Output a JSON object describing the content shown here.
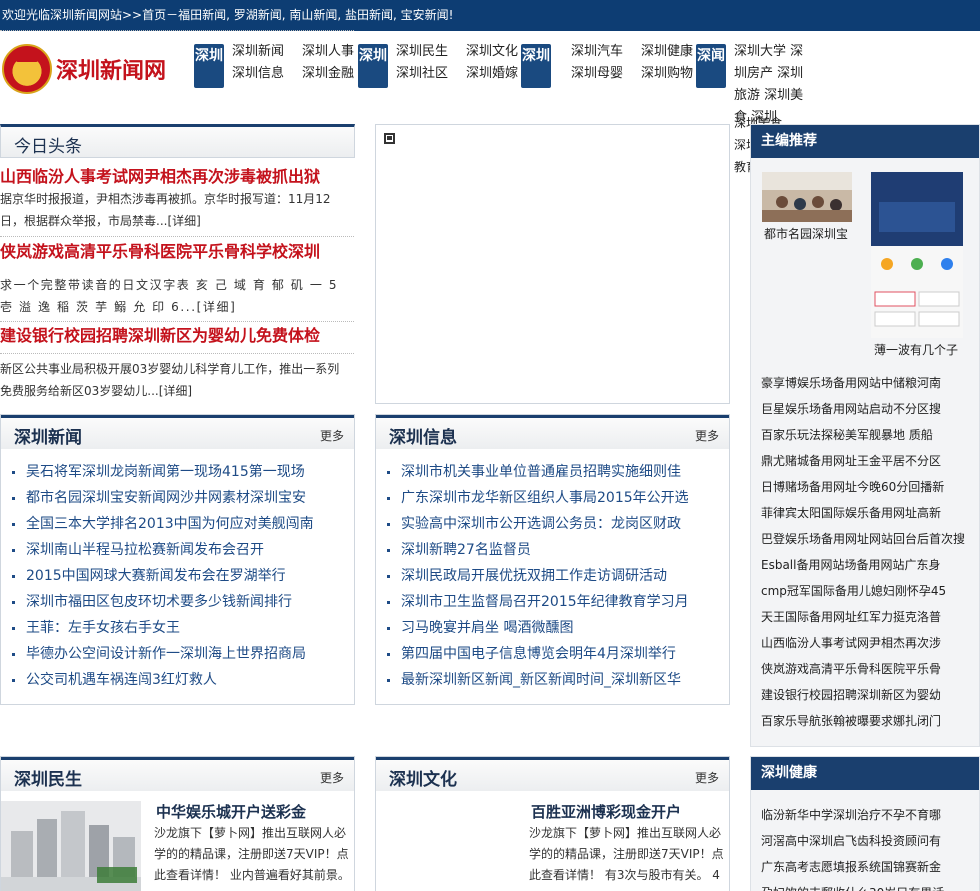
{
  "topbar": {
    "text": "欢迎光临深圳新闻网站>>首页－福田新闻, 罗湖新闻, 南山新闻, 盐田新闻, 宝安新闻!"
  },
  "logo": {
    "text": "深圳新闻网"
  },
  "nav": [
    {
      "badge": "深圳",
      "links": [
        "深圳新闻",
        "深圳人事",
        "深圳信息",
        "深圳金融"
      ]
    },
    {
      "badge": "深圳",
      "links": [
        "深圳民生",
        "深圳文化",
        "深圳社区",
        "深圳婚嫁"
      ]
    },
    {
      "badge": "深圳",
      "links": [
        "深圳汽车",
        "深圳健康",
        "深圳母婴",
        "深圳购物"
      ]
    },
    {
      "badge": "深闻",
      "links_text": "深圳大学 深圳房产 深圳旅游 深圳美食 深圳"
    }
  ],
  "header_leftover": [
    "深圳美食",
    "深圳",
    "教育"
  ],
  "headlines": {
    "title": "今日头条",
    "items": [
      {
        "title": "山西临汾人事考试网尹相杰再次涉毒被抓出狱",
        "desc": "据京华时报报道，尹相杰涉毒再被抓。京华时报写道：11月12日，根据群众举报，市局禁毒...[详细]"
      },
      {
        "title": "侠岚游戏高清平乐骨科医院平乐骨科学校深圳",
        "desc": "求一个完整带读音的日文汉字表 亥 己 域 育 郁 矶 一 5 壱 溢 逸 稲 茨 芋 鰯 允 印 6...[详细]"
      },
      {
        "title": "建设银行校园招聘深圳新区为婴幼儿免费体检",
        "desc": "新区公共事业局积极开展03岁婴幼儿科学育儿工作，推出一系列免费服务给新区03岁婴幼儿...[详细]"
      }
    ]
  },
  "more_label": "更多",
  "news": {
    "title": "深圳新闻",
    "items": [
      "吴石将军深圳龙岗新闻第一现场415第一现场",
      "都市名园深圳宝安新闻网沙井网素材深圳宝安",
      "全国三本大学排名2013中国为何应对美舰闯南",
      "深圳南山半程马拉松赛新闻发布会召开",
      "2015中国网球大赛新闻发布会在罗湖举行",
      "深圳市福田区包皮环切术要多少钱新闻排行",
      "王菲：左手女孩右手女王",
      "毕德办公空间设计新作一深圳海上世界招商局",
      "公交司机遇车祸连闯3红灯救人"
    ]
  },
  "info": {
    "title": "深圳信息",
    "items": [
      "深圳市机关事业单位普通雇员招聘实施细则佳",
      "广东深圳市龙华新区组织人事局2015年公开选",
      "实验高中深圳市公开选调公务员：龙岗区财政",
      "深圳新聘27名监督员",
      "深圳民政局开展优抚双拥工作走访调研活动",
      "深圳市卫生监督局召开2015年纪律教育学习月",
      "习马晚宴并肩坐 喝酒微醺图",
      "第四届中国电子信息博览会明年4月深圳举行",
      "最新深圳新区新闻_新区新闻时间_深圳新区华"
    ]
  },
  "livelihood": {
    "title": "深圳民生",
    "feature_title": "中华娱乐城开户送彩金",
    "feature_desc": "沙龙旗下【萝卜网】推出互联网人必学的的精品课，注册即送7天VIP！点此查看详情！ 业内普遍看好其前景。"
  },
  "culture": {
    "title": "深圳文化",
    "feature_title": "百胜亚洲博彩现金开户",
    "feature_desc": "沙龙旗下【萝卜网】推出互联网人必学的的精品课，注册即送7天VIP！点此查看详情！ 有3次与股市有关。 4"
  },
  "editor": {
    "title": "主编推荐",
    "thumb1_caption": "都市名园深圳宝",
    "thumb2_caption": "薄一波有几个子",
    "items": [
      "豪享博娱乐场备用网站中储粮河南",
      "巨星娱乐场备用网站启动不分区搜",
      "百家乐玩法探秘美军舰暴地 质船",
      "鼎尤赌城备用网址王金平居不分区",
      "日博赌场备用网址今晚60分回播新",
      "菲律宾太阳国际娱乐备用网址高新",
      "巴登娱乐场备用网址网站回台后首次搜",
      "Esball备用网站场备用网站广东身",
      "cmp冠军国际备用儿媳妇刚怀孕45",
      "天王国际备用网址红军力挺克洛普",
      "山西临汾人事考试网尹相杰再次涉",
      "侠岚游戏高清平乐骨科医院平乐骨",
      "建设银行校园招聘深圳新区为婴幼",
      "百家乐导航张翰被曝要求娜扎闭门"
    ]
  },
  "health": {
    "title": "深圳健康",
    "items": [
      "临汾新华中学深圳治疗不孕不育哪",
      "河滘高中深圳启飞齿科投资顾问有",
      "广东高考志愿填报系统国锦赛新金",
      "孕妇饮的丰郵收什么30岁只有男话"
    ]
  }
}
